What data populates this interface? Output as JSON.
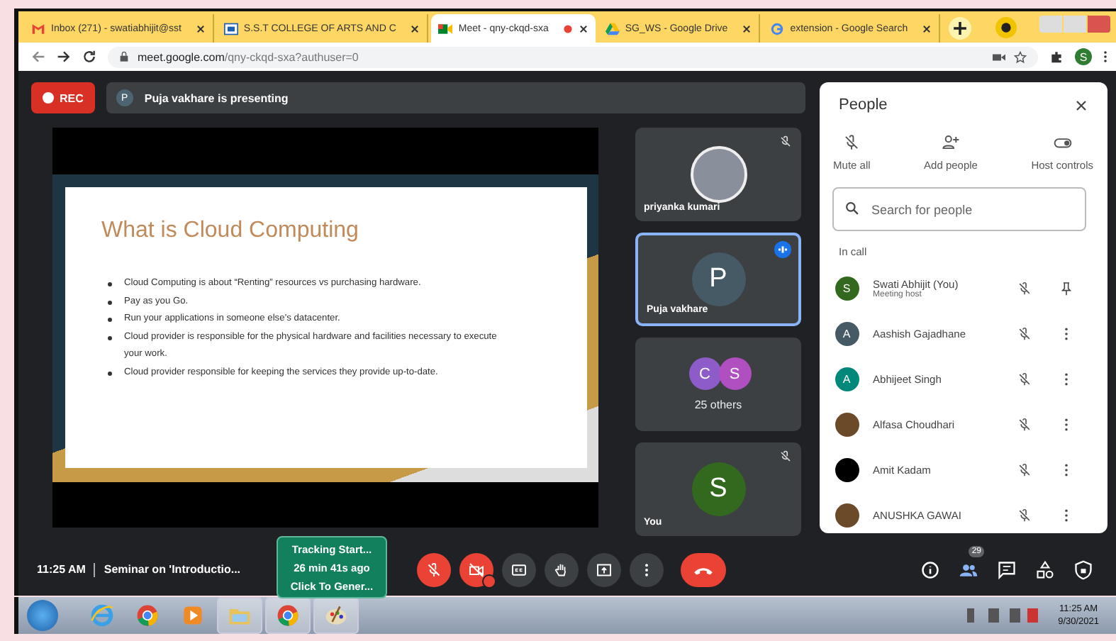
{
  "browser": {
    "tabs": [
      {
        "title": "Inbox (271) - swatiabhijit@sst",
        "kind": "mail",
        "selected": false,
        "recording": false
      },
      {
        "title": "S.S.T COLLEGE OF ARTS AND C",
        "kind": "college",
        "selected": false,
        "recording": false
      },
      {
        "title": "Meet - qny-ckqd-sxa",
        "kind": "meet",
        "selected": true,
        "recording": true
      },
      {
        "title": "SG_WS - Google Drive",
        "kind": "drive",
        "selected": false,
        "recording": false
      },
      {
        "title": "extension - Google Search",
        "kind": "search",
        "selected": false,
        "recording": false
      }
    ],
    "profile_initial": "S",
    "url_host": "meet.google.com",
    "url_path": "/qny-ckqd-sxa?authuser=0"
  },
  "meet": {
    "rec_label": "REC",
    "presenter": {
      "initial": "P",
      "text": "Puja vakhare is presenting"
    },
    "slide": {
      "title": "What is Cloud Computing",
      "bullets": [
        "Cloud Computing is about “Renting”  resources vs purchasing hardware.",
        "Pay as you Go.",
        "Run your applications in someone else’s datacenter.",
        "Cloud provider is responsible for the physical hardware and facilities necessary to execute your work.",
        "Cloud provider responsible for keeping the services they provide up-to-date."
      ]
    },
    "tiles": [
      {
        "kind": "photo",
        "name": "priyanka kumari",
        "muted": true,
        "speaking": false
      },
      {
        "kind": "avatar",
        "name": "Puja vakhare",
        "initial": "P",
        "color": "#455a64",
        "muted": false,
        "speaking": true
      },
      {
        "kind": "group",
        "name": "25 others",
        "avatars": [
          {
            "initial": "C",
            "color": "#8e5cc9"
          },
          {
            "initial": "S",
            "color": "#b04fc0"
          }
        ]
      },
      {
        "kind": "avatar",
        "name": "You",
        "initial": "S",
        "color": "#33691e",
        "muted": true,
        "speaking": false
      }
    ]
  },
  "people": {
    "title": "People",
    "actions": [
      {
        "kind": "mute",
        "label": "Mute all"
      },
      {
        "kind": "add",
        "label": "Add people"
      },
      {
        "kind": "toggle",
        "label": "Host controls"
      }
    ],
    "search": {
      "placeholder": "Search for people"
    },
    "section": "In call",
    "participants": [
      {
        "kind": "host",
        "name": "Swati Abhijit (You)",
        "subtitle": "Meeting host",
        "avatar": {
          "kind": "initial",
          "initial": "S",
          "color": "#33691e"
        },
        "muted": true
      },
      {
        "kind": "guest",
        "name": "Aashish Gajadhane",
        "avatar": {
          "kind": "initial",
          "initial": "A",
          "color": "#455a64"
        },
        "muted": true
      },
      {
        "kind": "guest",
        "name": "Abhijeet Singh",
        "avatar": {
          "kind": "initial",
          "initial": "A",
          "color": "#00897b"
        },
        "muted": true
      },
      {
        "kind": "guest",
        "name": "Alfasa Choudhari",
        "avatar": {
          "kind": "photo"
        },
        "muted": true
      },
      {
        "kind": "guest",
        "name": "Amit Kadam",
        "avatar": {
          "kind": "blank",
          "color": "#000000"
        },
        "muted": true
      },
      {
        "kind": "guest",
        "name": "ANUSHKA GAWAI",
        "avatar": {
          "kind": "photo"
        },
        "muted": true
      }
    ]
  },
  "bottom": {
    "time": "11:25 AM",
    "meeting_title": "Seminar on 'Introductio...",
    "tracking": [
      "Tracking Start...",
      "26 min 41s ago",
      "Click To Gener..."
    ],
    "controls": [
      {
        "kind": "mic",
        "off": true
      },
      {
        "kind": "camera",
        "off": true
      },
      {
        "kind": "captions",
        "off": false
      },
      {
        "kind": "hand",
        "off": false
      },
      {
        "kind": "present",
        "off": false
      },
      {
        "kind": "more",
        "off": false
      },
      {
        "kind": "leave"
      }
    ],
    "right": [
      {
        "kind": "info"
      },
      {
        "kind": "people",
        "badge": "29"
      },
      {
        "kind": "chat"
      },
      {
        "kind": "activities"
      },
      {
        "kind": "safety"
      }
    ]
  },
  "taskbar": {
    "apps": [
      {
        "kind": "ie",
        "selected": false
      },
      {
        "kind": "chrome",
        "selected": false
      },
      {
        "kind": "media",
        "selected": false
      },
      {
        "kind": "folder",
        "selected": true
      },
      {
        "kind": "chrome",
        "selected": true
      },
      {
        "kind": "paint",
        "selected": true
      }
    ],
    "time": "11:25 AM",
    "date": "9/30/2021"
  }
}
